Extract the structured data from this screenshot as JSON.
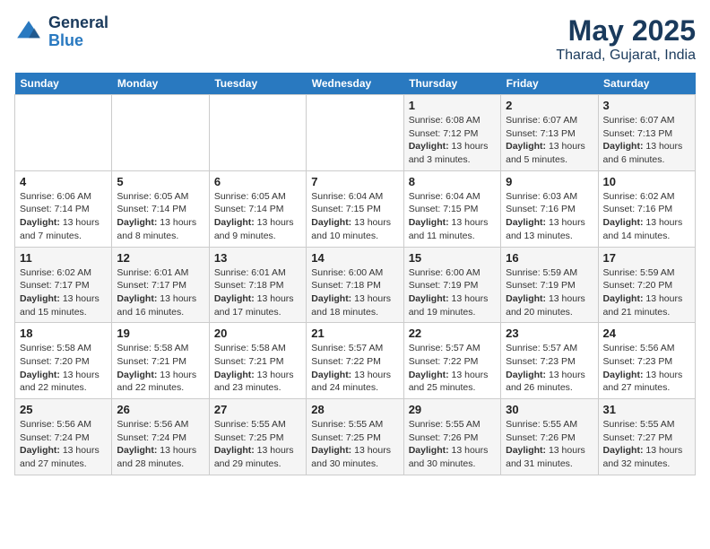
{
  "logo": {
    "text_general": "General",
    "text_blue": "Blue"
  },
  "title": "May 2025",
  "subtitle": "Tharad, Gujarat, India",
  "days_of_week": [
    "Sunday",
    "Monday",
    "Tuesday",
    "Wednesday",
    "Thursday",
    "Friday",
    "Saturday"
  ],
  "weeks": [
    [
      {
        "day": "",
        "info": ""
      },
      {
        "day": "",
        "info": ""
      },
      {
        "day": "",
        "info": ""
      },
      {
        "day": "",
        "info": ""
      },
      {
        "day": "1",
        "info": "Sunrise: 6:08 AM\nSunset: 7:12 PM\nDaylight: 13 hours and 3 minutes."
      },
      {
        "day": "2",
        "info": "Sunrise: 6:07 AM\nSunset: 7:13 PM\nDaylight: 13 hours and 5 minutes."
      },
      {
        "day": "3",
        "info": "Sunrise: 6:07 AM\nSunset: 7:13 PM\nDaylight: 13 hours and 6 minutes."
      }
    ],
    [
      {
        "day": "4",
        "info": "Sunrise: 6:06 AM\nSunset: 7:14 PM\nDaylight: 13 hours and 7 minutes."
      },
      {
        "day": "5",
        "info": "Sunrise: 6:05 AM\nSunset: 7:14 PM\nDaylight: 13 hours and 8 minutes."
      },
      {
        "day": "6",
        "info": "Sunrise: 6:05 AM\nSunset: 7:14 PM\nDaylight: 13 hours and 9 minutes."
      },
      {
        "day": "7",
        "info": "Sunrise: 6:04 AM\nSunset: 7:15 PM\nDaylight: 13 hours and 10 minutes."
      },
      {
        "day": "8",
        "info": "Sunrise: 6:04 AM\nSunset: 7:15 PM\nDaylight: 13 hours and 11 minutes."
      },
      {
        "day": "9",
        "info": "Sunrise: 6:03 AM\nSunset: 7:16 PM\nDaylight: 13 hours and 13 minutes."
      },
      {
        "day": "10",
        "info": "Sunrise: 6:02 AM\nSunset: 7:16 PM\nDaylight: 13 hours and 14 minutes."
      }
    ],
    [
      {
        "day": "11",
        "info": "Sunrise: 6:02 AM\nSunset: 7:17 PM\nDaylight: 13 hours and 15 minutes."
      },
      {
        "day": "12",
        "info": "Sunrise: 6:01 AM\nSunset: 7:17 PM\nDaylight: 13 hours and 16 minutes."
      },
      {
        "day": "13",
        "info": "Sunrise: 6:01 AM\nSunset: 7:18 PM\nDaylight: 13 hours and 17 minutes."
      },
      {
        "day": "14",
        "info": "Sunrise: 6:00 AM\nSunset: 7:18 PM\nDaylight: 13 hours and 18 minutes."
      },
      {
        "day": "15",
        "info": "Sunrise: 6:00 AM\nSunset: 7:19 PM\nDaylight: 13 hours and 19 minutes."
      },
      {
        "day": "16",
        "info": "Sunrise: 5:59 AM\nSunset: 7:19 PM\nDaylight: 13 hours and 20 minutes."
      },
      {
        "day": "17",
        "info": "Sunrise: 5:59 AM\nSunset: 7:20 PM\nDaylight: 13 hours and 21 minutes."
      }
    ],
    [
      {
        "day": "18",
        "info": "Sunrise: 5:58 AM\nSunset: 7:20 PM\nDaylight: 13 hours and 22 minutes."
      },
      {
        "day": "19",
        "info": "Sunrise: 5:58 AM\nSunset: 7:21 PM\nDaylight: 13 hours and 22 minutes."
      },
      {
        "day": "20",
        "info": "Sunrise: 5:58 AM\nSunset: 7:21 PM\nDaylight: 13 hours and 23 minutes."
      },
      {
        "day": "21",
        "info": "Sunrise: 5:57 AM\nSunset: 7:22 PM\nDaylight: 13 hours and 24 minutes."
      },
      {
        "day": "22",
        "info": "Sunrise: 5:57 AM\nSunset: 7:22 PM\nDaylight: 13 hours and 25 minutes."
      },
      {
        "day": "23",
        "info": "Sunrise: 5:57 AM\nSunset: 7:23 PM\nDaylight: 13 hours and 26 minutes."
      },
      {
        "day": "24",
        "info": "Sunrise: 5:56 AM\nSunset: 7:23 PM\nDaylight: 13 hours and 27 minutes."
      }
    ],
    [
      {
        "day": "25",
        "info": "Sunrise: 5:56 AM\nSunset: 7:24 PM\nDaylight: 13 hours and 27 minutes."
      },
      {
        "day": "26",
        "info": "Sunrise: 5:56 AM\nSunset: 7:24 PM\nDaylight: 13 hours and 28 minutes."
      },
      {
        "day": "27",
        "info": "Sunrise: 5:55 AM\nSunset: 7:25 PM\nDaylight: 13 hours and 29 minutes."
      },
      {
        "day": "28",
        "info": "Sunrise: 5:55 AM\nSunset: 7:25 PM\nDaylight: 13 hours and 30 minutes."
      },
      {
        "day": "29",
        "info": "Sunrise: 5:55 AM\nSunset: 7:26 PM\nDaylight: 13 hours and 30 minutes."
      },
      {
        "day": "30",
        "info": "Sunrise: 5:55 AM\nSunset: 7:26 PM\nDaylight: 13 hours and 31 minutes."
      },
      {
        "day": "31",
        "info": "Sunrise: 5:55 AM\nSunset: 7:27 PM\nDaylight: 13 hours and 32 minutes."
      }
    ]
  ]
}
